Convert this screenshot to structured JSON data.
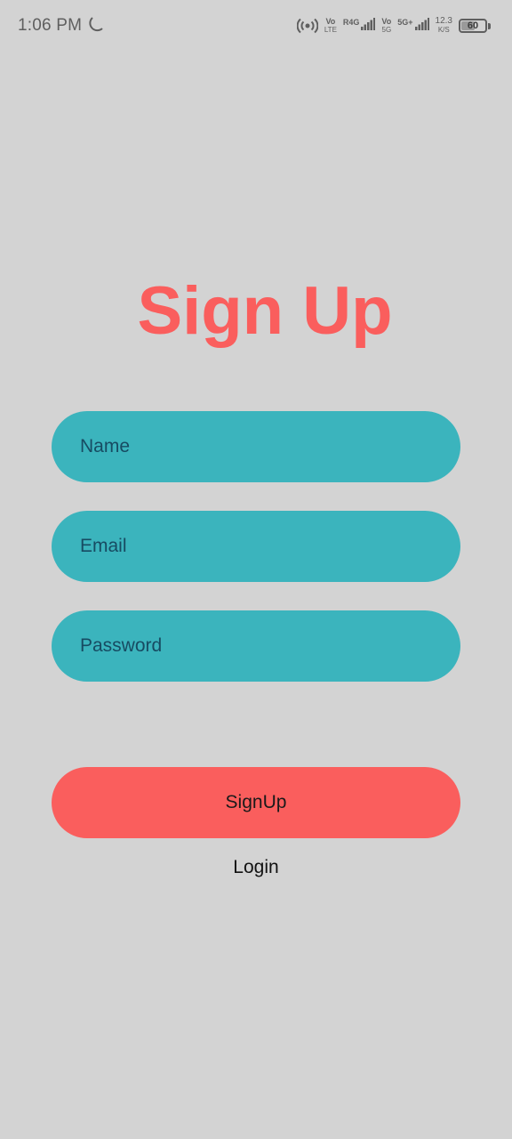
{
  "status_bar": {
    "time": "1:06 PM",
    "network_1_top": "Vo",
    "network_1_bottom": "LTE",
    "network_2": "R4G",
    "network_3_top": "Vo",
    "network_3_bottom": "5G",
    "network_4": "5G+",
    "speed_value": "12.3",
    "speed_unit": "K/S",
    "battery_level": "60",
    "battery_fraction": 0.6
  },
  "screen": {
    "title": "Sign Up",
    "fields": {
      "name_placeholder": "Name",
      "email_placeholder": "Email",
      "password_placeholder": "Password"
    },
    "signup_label": "SignUp",
    "login_label": "Login"
  },
  "colors": {
    "background": "#d3d3d3",
    "title": "#fa5e5d",
    "field_background": "#3bb4bd",
    "field_text": "#174b62",
    "button_background": "#fa5e5d"
  },
  "icons": {
    "moon": "moon-icon",
    "hotspot": "hotspot-icon",
    "signal": "signal-icon",
    "battery": "battery-icon"
  }
}
